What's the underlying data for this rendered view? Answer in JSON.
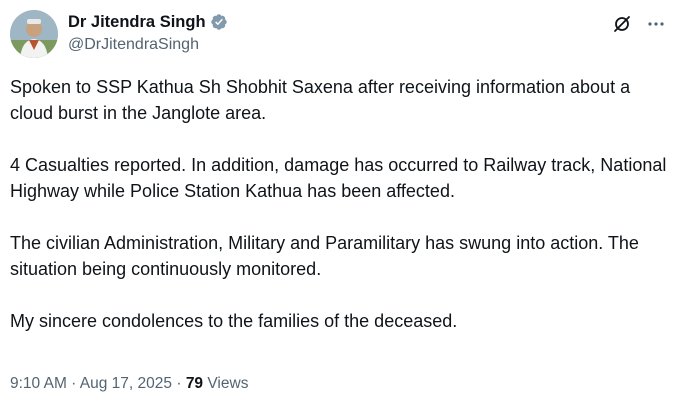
{
  "author": {
    "display_name": "Dr Jitendra Singh",
    "handle": "@DrJitendraSingh"
  },
  "icons": {
    "verified": "verified-badge-icon",
    "grok": "grok-icon",
    "more": "more-options-icon"
  },
  "colors": {
    "verified_badge": "#829aab",
    "secondary_text": "#536471",
    "primary_text": "#0f1419"
  },
  "tweet": {
    "paragraphs": [
      "Spoken to SSP Kathua Sh Shobhit Saxena after receiving information about a cloud burst in the Janglote area.",
      "4 Casualties reported. In addition, damage has occurred to Railway track, National Highway while Police Station Kathua has been affected.",
      "The civilian Administration, Military and Paramilitary has swung into action. The situation being continuously monitored.",
      "My sincere condolences to the families of the deceased."
    ]
  },
  "meta": {
    "time": "9:10 AM",
    "separator": " · ",
    "date": "Aug 17, 2025",
    "views_count": "79",
    "views_label": "Views"
  }
}
